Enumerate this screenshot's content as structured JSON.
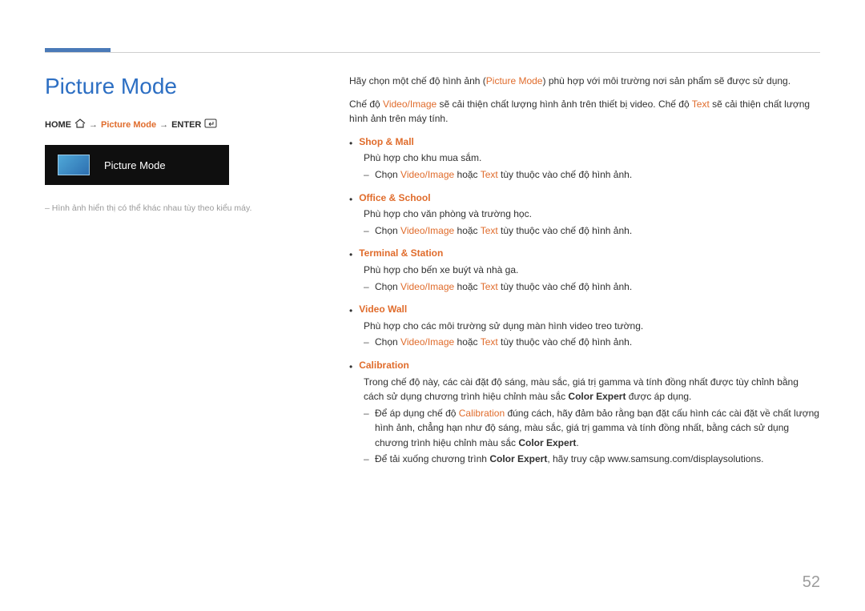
{
  "title": "Picture Mode",
  "breadcrumb": {
    "home": "HOME",
    "mid": "Picture Mode",
    "enter": "ENTER"
  },
  "preview": {
    "label": "Picture Mode"
  },
  "footnote": "Hình ảnh hiển thị có thể khác nhau tùy theo kiểu máy.",
  "right": {
    "intro_pre": "Hãy chọn một chế độ hình ảnh (",
    "intro_accent": "Picture Mode",
    "intro_post": ") phù hợp với môi trường nơi sản phẩm sẽ được sử dụng.",
    "para2_pre": "Chế độ ",
    "para2_vi": "Video/Image",
    "para2_mid": " sẽ cải thiện chất lượng hình ảnh trên thiết bị video. Chế độ ",
    "para2_text": "Text",
    "para2_post": " sẽ cải thiện chất lượng hình ảnh trên máy tính.",
    "choose_pre": "Chọn ",
    "vi": "Video/Image",
    "or": " hoặc ",
    "text_label": "Text",
    "choose_post": " tùy thuộc vào chế độ hình ảnh."
  },
  "modes": [
    {
      "name": "Shop & Mall",
      "desc": "Phù hợp cho khu mua sắm.",
      "choose": true
    },
    {
      "name": "Office & School",
      "desc": "Phù hợp cho văn phòng và trường học.",
      "choose": true
    },
    {
      "name": "Terminal & Station",
      "desc": "Phù hợp cho bến xe buýt và nhà ga.",
      "choose": true
    },
    {
      "name": "Video Wall",
      "desc": "Phù hợp cho các môi trường sử dụng màn hình video treo tường.",
      "choose": true
    }
  ],
  "calibration": {
    "name": "Calibration",
    "desc_pre": "Trong chế độ này, các cài đặt độ sáng, màu sắc, giá trị gamma và tính đồng nhất được tùy chỉnh bằng cách sử dụng chương trình hiệu chỉnh màu sắc ",
    "desc_bold": "Color Expert",
    "desc_post": " được áp dụng.",
    "sub1_pre": "Để áp dụng chế độ ",
    "sub1_accent": "Calibration",
    "sub1_mid": " đúng cách, hãy đảm bảo rằng bạn đặt cấu hình các cài đặt về chất lượng hình ảnh, chẳng hạn như độ sáng, màu sắc, giá trị gamma và tính đồng nhất, bằng cách sử dụng chương trình hiệu chỉnh màu sắc ",
    "sub1_bold": "Color Expert",
    "sub1_post": ".",
    "sub2_pre": "Để tải xuống chương trình ",
    "sub2_bold": "Color Expert",
    "sub2_post": ", hãy truy cập www.samsung.com/displaysolutions."
  },
  "page_number": "52"
}
